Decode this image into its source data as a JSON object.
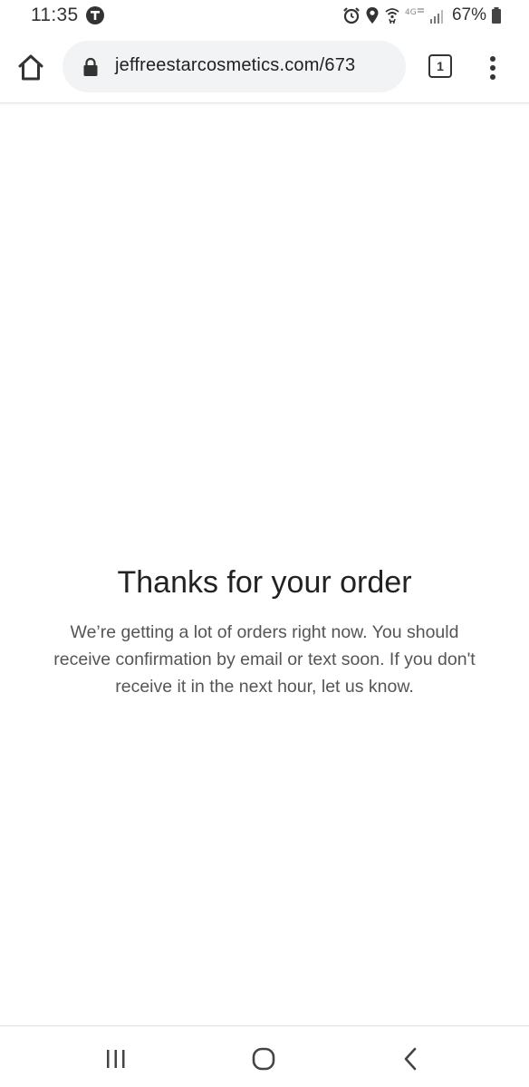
{
  "status_bar": {
    "time": "11:35",
    "battery_percent": "67%",
    "icons": [
      "t-mobile-icon",
      "alarm-icon",
      "location-icon",
      "wifi-calling-icon",
      "4g-lte-icon",
      "signal-icon",
      "battery-icon"
    ],
    "network_label": "4G"
  },
  "browser": {
    "url": "jeffreestarcosmetics.com/673",
    "tab_count": "1",
    "icons": [
      "home-icon",
      "lock-icon",
      "tabs-icon",
      "more-vert-icon"
    ]
  },
  "page": {
    "title": "Thanks for your order",
    "message": "We’re getting a lot of orders right now. You should receive confirmation by email or text soon. If you don't receive it in the next hour, let us know."
  },
  "nav_bar": {
    "icons": [
      "recent-apps-icon",
      "home-circle-icon",
      "back-icon"
    ]
  }
}
